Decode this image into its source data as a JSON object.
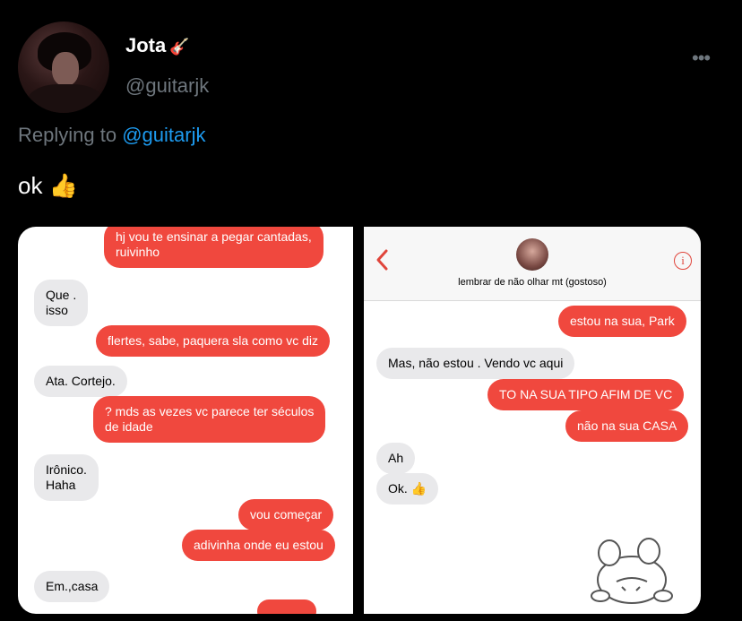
{
  "user": {
    "name": "Jota",
    "emoji": "🎸",
    "handle": "@guitarjk"
  },
  "more_icon": "•••",
  "reply": {
    "prefix": "Replying to",
    "mention": "@guitarjk"
  },
  "tweet_text": "ok 👍",
  "left_chat": [
    {
      "type": "sent",
      "text": "hj vou te ensinar a pegar cantadas,\nruivinho"
    },
    {
      "type": "recv",
      "text": "Que .\nisso"
    },
    {
      "type": "sent",
      "text": "flertes, sabe, paquera sla como vc diz"
    },
    {
      "type": "recv",
      "text": "Ata. Cortejo."
    },
    {
      "type": "sent",
      "text": "? mds as vezes vc parece ter séculos\nde idade"
    },
    {
      "type": "recv",
      "text": "Irônico.\nHaha"
    },
    {
      "type": "sent",
      "text": "vou começar"
    },
    {
      "type": "sent",
      "text": "adivinha onde eu estou"
    },
    {
      "type": "recv",
      "text": "Em.,casa"
    }
  ],
  "right_header": {
    "contact": "lembrar de não olhar mt (gostoso)",
    "back_icon": "chevron-left-icon",
    "info_icon": "i"
  },
  "right_chat": [
    {
      "type": "sent",
      "text": "estou na sua, Park"
    },
    {
      "type": "recv",
      "text": "Mas, não estou . Vendo vc aqui"
    },
    {
      "type": "sent",
      "text": "TO NA SUA TIPO AFIM DE VC"
    },
    {
      "type": "sent",
      "text": "não na sua CASA"
    },
    {
      "type": "recv",
      "text": "Ah"
    },
    {
      "type": "recv",
      "text": "Ok. 👍"
    }
  ],
  "colors": {
    "bubble_sent": "#f0483e",
    "bubble_recv": "#e9e9eb",
    "mention": "#1d9bf0",
    "muted": "#6e767d"
  }
}
